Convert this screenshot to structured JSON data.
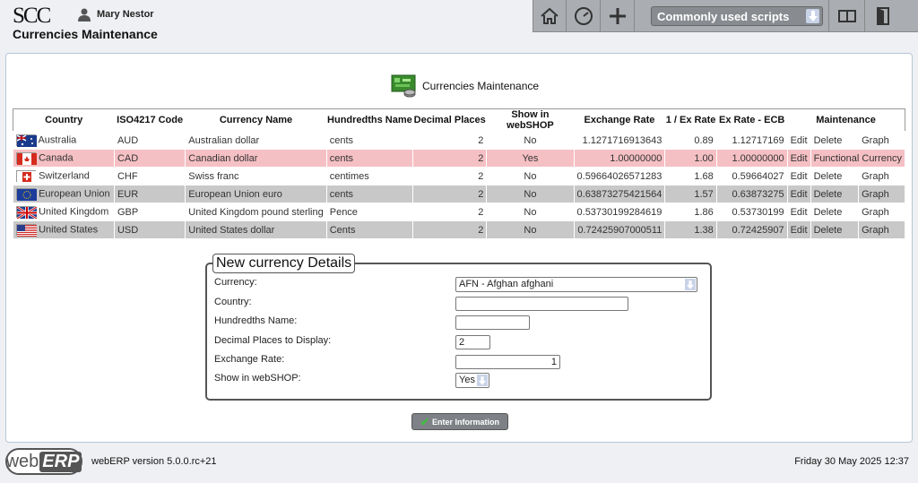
{
  "header": {
    "logo": "SCC",
    "user_name": "Mary Nestor",
    "page_title": "Currencies Maintenance",
    "scripts_label": "Commonly used scripts"
  },
  "main": {
    "heading": "Currencies Maintenance",
    "columns": [
      "Country",
      "ISO4217 Code",
      "Currency Name",
      "Hundredths Name",
      "Decimal Places",
      "Show in webSHOP",
      "Exchange Rate",
      "1 / Ex Rate",
      "Ex Rate - ECB",
      "Maintenance"
    ],
    "rows": [
      {
        "country": "Australia",
        "code": "AUD",
        "name": "Australian dollar",
        "hundredths": "cents",
        "decimals": "2",
        "webshop": "No",
        "rate": "1.1271716913643",
        "inv": "0.89",
        "ecb": "1.12717169",
        "edit": "Edit",
        "action": "Delete",
        "graph": "Graph",
        "flag": "au"
      },
      {
        "country": "Canada",
        "code": "CAD",
        "name": "Canadian dollar",
        "hundredths": "cents",
        "decimals": "2",
        "webshop": "Yes",
        "rate": "1.00000000",
        "inv": "1.00",
        "ecb": "1.00000000",
        "edit": "Edit",
        "action": "Functional Currency",
        "graph": "",
        "flag": "ca"
      },
      {
        "country": "Switzerland",
        "code": "CHF",
        "name": "Swiss franc",
        "hundredths": "centimes",
        "decimals": "2",
        "webshop": "No",
        "rate": "0.59664026571283",
        "inv": "1.68",
        "ecb": "0.59664027",
        "edit": "Edit",
        "action": "Delete",
        "graph": "Graph",
        "flag": "ch"
      },
      {
        "country": "European Union",
        "code": "EUR",
        "name": "European Union euro",
        "hundredths": "cents",
        "decimals": "2",
        "webshop": "No",
        "rate": "0.63873275421564",
        "inv": "1.57",
        "ecb": "0.63873275",
        "edit": "Edit",
        "action": "Delete",
        "graph": "Graph",
        "flag": "eu"
      },
      {
        "country": "United Kingdom",
        "code": "GBP",
        "name": "United Kingdom pound sterling",
        "hundredths": "Pence",
        "decimals": "2",
        "webshop": "No",
        "rate": "0.53730199284619",
        "inv": "1.86",
        "ecb": "0.53730199",
        "edit": "Edit",
        "action": "Delete",
        "graph": "Graph",
        "flag": "gb"
      },
      {
        "country": "United States",
        "code": "USD",
        "name": "United States dollar",
        "hundredths": "Cents",
        "decimals": "2",
        "webshop": "No",
        "rate": "0.72425907000511",
        "inv": "1.38",
        "ecb": "0.72425907",
        "edit": "Edit",
        "action": "Delete",
        "graph": "Graph",
        "flag": "us"
      }
    ]
  },
  "form": {
    "legend": "New currency Details",
    "currency_label": "Currency:",
    "currency_value": "AFN - Afghan afghani",
    "country_label": "Country:",
    "country_value": "",
    "hundredths_label": "Hundredths Name:",
    "hundredths_value": "",
    "decimals_label": "Decimal Places to Display:",
    "decimals_value": "2",
    "rate_label": "Exchange Rate:",
    "rate_value": "1",
    "webshop_label": "Show in webSHOP:",
    "webshop_value": "Yes",
    "submit_label": "Enter Information"
  },
  "footer": {
    "brand_a": "web",
    "brand_b": "ERP",
    "version": "webERP version 5.0.0.rc+21",
    "datetime": "Friday 30 May 2025 12:37"
  },
  "colors": {
    "functional_row": "#f5c0c4",
    "even_row": "#c8c8c8",
    "toolbar": "#aaadb1"
  },
  "icons": [
    "user-icon",
    "home-icon",
    "dashboard-icon",
    "plus-icon",
    "manual-icon",
    "logout-icon",
    "currency-icon",
    "checkmark-icon"
  ]
}
